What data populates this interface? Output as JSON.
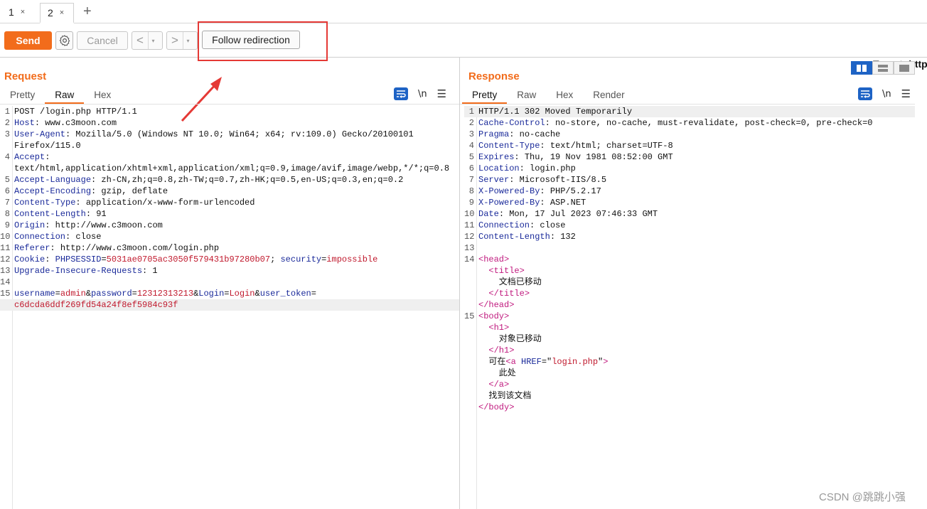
{
  "tabs": [
    {
      "label": "1",
      "close": "×"
    },
    {
      "label": "2",
      "close": "×"
    }
  ],
  "tab_add": "+",
  "toolbar": {
    "send": "Send",
    "cancel": "Cancel",
    "back": "<",
    "forward": ">",
    "dropdown": "▾",
    "follow_redirection": "Follow redirection",
    "target_label": "Target: http"
  },
  "request": {
    "title": "Request",
    "tabs": [
      "Pretty",
      "Raw",
      "Hex"
    ],
    "active_tab": "Raw",
    "newline_icon": "\\n",
    "lines": [
      {
        "n": "1",
        "parts": [
          [
            "",
            "POST /login.php HTTP/1.1"
          ]
        ]
      },
      {
        "n": "2",
        "parts": [
          [
            "k",
            "Host"
          ],
          [
            "",
            ": www.c3moon.com"
          ]
        ]
      },
      {
        "n": "3",
        "parts": [
          [
            "k",
            "User-Agent"
          ],
          [
            "",
            ": Mozilla/5.0 (Windows NT 10.0; Win64; x64; rv:109.0) Gecko/20100101"
          ]
        ]
      },
      {
        "n": "",
        "parts": [
          [
            "",
            "Firefox/115.0"
          ]
        ]
      },
      {
        "n": "4",
        "parts": [
          [
            "k",
            "Accept"
          ],
          [
            "",
            ":"
          ]
        ]
      },
      {
        "n": "",
        "parts": [
          [
            "",
            "text/html,application/xhtml+xml,application/xml;q=0.9,image/avif,image/webp,*/*;q=0.8"
          ]
        ]
      },
      {
        "n": "5",
        "parts": [
          [
            "k",
            "Accept-Language"
          ],
          [
            "",
            ": zh-CN,zh;q=0.8,zh-TW;q=0.7,zh-HK;q=0.5,en-US;q=0.3,en;q=0.2"
          ]
        ]
      },
      {
        "n": "6",
        "parts": [
          [
            "k",
            "Accept-Encoding"
          ],
          [
            "",
            ": gzip, deflate"
          ]
        ]
      },
      {
        "n": "7",
        "parts": [
          [
            "k",
            "Content-Type"
          ],
          [
            "",
            ": application/x-www-form-urlencoded"
          ]
        ]
      },
      {
        "n": "8",
        "parts": [
          [
            "k",
            "Content-Length"
          ],
          [
            "",
            ": 91"
          ]
        ]
      },
      {
        "n": "9",
        "parts": [
          [
            "k",
            "Origin"
          ],
          [
            "",
            ": http://www.c3moon.com"
          ]
        ]
      },
      {
        "n": "10",
        "parts": [
          [
            "k",
            "Connection"
          ],
          [
            "",
            ": close"
          ]
        ]
      },
      {
        "n": "11",
        "parts": [
          [
            "k",
            "Referer"
          ],
          [
            "",
            ": http://www.c3moon.com/login.php"
          ]
        ]
      },
      {
        "n": "12",
        "parts": [
          [
            "k",
            "Cookie"
          ],
          [
            "",
            ": "
          ],
          [
            "k",
            "PHPSESSID"
          ],
          [
            "",
            "="
          ],
          [
            "v",
            "5031ae0705ac3050f579431b97280b07"
          ],
          [
            "",
            "; "
          ],
          [
            "k",
            "security"
          ],
          [
            "",
            "="
          ],
          [
            "v",
            "impossible"
          ]
        ]
      },
      {
        "n": "13",
        "parts": [
          [
            "k",
            "Upgrade-Insecure-Requests"
          ],
          [
            "",
            ": 1"
          ]
        ]
      },
      {
        "n": "14",
        "parts": []
      },
      {
        "n": "15",
        "parts": [
          [
            "k",
            "username"
          ],
          [
            "",
            "="
          ],
          [
            "v",
            "admin"
          ],
          [
            "",
            "&"
          ],
          [
            "k",
            "password"
          ],
          [
            "",
            "="
          ],
          [
            "v",
            "12312313213"
          ],
          [
            "",
            "&"
          ],
          [
            "k",
            "Login"
          ],
          [
            "",
            "="
          ],
          [
            "v",
            "Login"
          ],
          [
            "",
            "&"
          ],
          [
            "k",
            "user_token"
          ],
          [
            "",
            "="
          ]
        ]
      },
      {
        "n": "",
        "cur": true,
        "parts": [
          [
            "v",
            "c6dcda6ddf269fd54a24f8ef5984c93f"
          ]
        ]
      }
    ]
  },
  "response": {
    "title": "Response",
    "tabs": [
      "Pretty",
      "Raw",
      "Hex",
      "Render"
    ],
    "active_tab": "Pretty",
    "newline_icon": "\\n",
    "lines": [
      {
        "n": "1",
        "cur": true,
        "parts": [
          [
            "",
            "HTTP/1.1 302 Moved Temporarily"
          ]
        ]
      },
      {
        "n": "2",
        "parts": [
          [
            "k",
            "Cache-Control"
          ],
          [
            "",
            ": no-store, no-cache, must-revalidate, post-check=0, pre-check=0"
          ]
        ]
      },
      {
        "n": "3",
        "parts": [
          [
            "k",
            "Pragma"
          ],
          [
            "",
            ": no-cache"
          ]
        ]
      },
      {
        "n": "4",
        "parts": [
          [
            "k",
            "Content-Type"
          ],
          [
            "",
            ": text/html; charset=UTF-8"
          ]
        ]
      },
      {
        "n": "5",
        "parts": [
          [
            "k",
            "Expires"
          ],
          [
            "",
            ": Thu, 19 Nov 1981 08:52:00 GMT"
          ]
        ]
      },
      {
        "n": "6",
        "parts": [
          [
            "k",
            "Location"
          ],
          [
            "",
            ": login.php"
          ]
        ]
      },
      {
        "n": "7",
        "parts": [
          [
            "k",
            "Server"
          ],
          [
            "",
            ": Microsoft-IIS/8.5"
          ]
        ]
      },
      {
        "n": "8",
        "parts": [
          [
            "k",
            "X-Powered-By"
          ],
          [
            "",
            ": PHP/5.2.17"
          ]
        ]
      },
      {
        "n": "9",
        "parts": [
          [
            "k",
            "X-Powered-By"
          ],
          [
            "",
            ": ASP.NET"
          ]
        ]
      },
      {
        "n": "10",
        "parts": [
          [
            "k",
            "Date"
          ],
          [
            "",
            ": Mon, 17 Jul 2023 07:46:33 GMT"
          ]
        ]
      },
      {
        "n": "11",
        "parts": [
          [
            "k",
            "Connection"
          ],
          [
            "",
            ": close"
          ]
        ]
      },
      {
        "n": "12",
        "parts": [
          [
            "k",
            "Content-Length"
          ],
          [
            "",
            ": 132"
          ]
        ]
      },
      {
        "n": "13",
        "parts": []
      },
      {
        "n": "14",
        "parts": [
          [
            "tg",
            "<head>"
          ]
        ]
      },
      {
        "n": "",
        "parts": [
          [
            "",
            "  "
          ],
          [
            "tg",
            "<title>"
          ]
        ]
      },
      {
        "n": "",
        "parts": [
          [
            "",
            "    文档已移动"
          ]
        ]
      },
      {
        "n": "",
        "parts": [
          [
            "",
            "  "
          ],
          [
            "tg",
            "</title>"
          ]
        ]
      },
      {
        "n": "",
        "parts": [
          [
            "tg",
            "</head>"
          ]
        ]
      },
      {
        "n": "15",
        "parts": [
          [
            "tg",
            "<body>"
          ]
        ]
      },
      {
        "n": "",
        "parts": [
          [
            "",
            "  "
          ],
          [
            "tg",
            "<h1>"
          ]
        ]
      },
      {
        "n": "",
        "parts": [
          [
            "",
            "    对象已移动"
          ]
        ]
      },
      {
        "n": "",
        "parts": [
          [
            "",
            "  "
          ],
          [
            "tg",
            "</h1>"
          ]
        ]
      },
      {
        "n": "",
        "parts": [
          [
            "",
            "  可在"
          ],
          [
            "tg",
            "<a "
          ],
          [
            "at",
            "HREF"
          ],
          [
            "",
            "=\""
          ],
          [
            "v",
            "login.php"
          ],
          [
            "",
            "\""
          ],
          [
            "tg",
            ">"
          ]
        ]
      },
      {
        "n": "",
        "parts": [
          [
            "",
            "    此处"
          ]
        ]
      },
      {
        "n": "",
        "parts": [
          [
            "",
            "  "
          ],
          [
            "tg",
            "</a>"
          ]
        ]
      },
      {
        "n": "",
        "parts": [
          [
            "",
            "  找到该文档"
          ]
        ]
      },
      {
        "n": "",
        "parts": [
          [
            "tg",
            "</body>"
          ]
        ]
      }
    ]
  },
  "watermark": "CSDN @跳跳小强",
  "colors": {
    "accent": "#f26c1b",
    "blue": "#1e63c5",
    "annotation_red": "#e53935"
  }
}
